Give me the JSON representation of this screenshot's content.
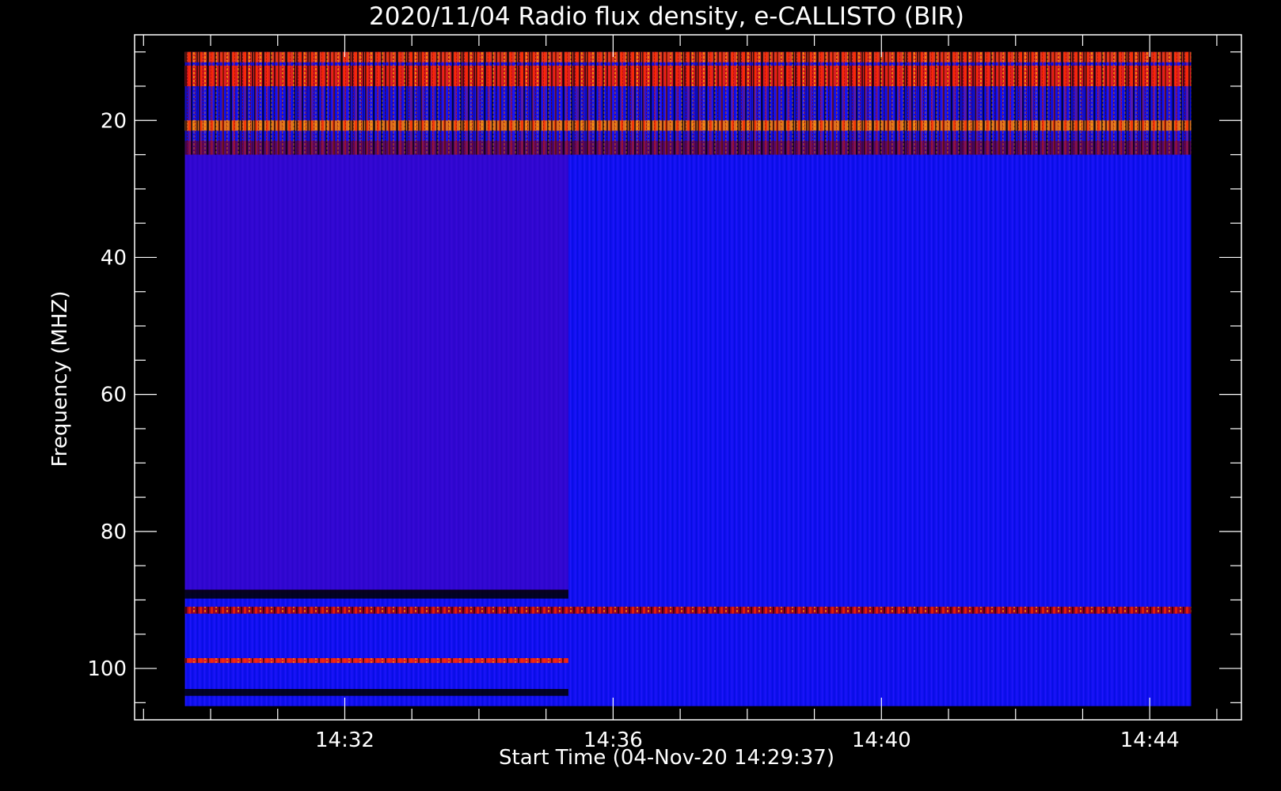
{
  "chart_data": {
    "type": "heatmap",
    "title": "2020/11/04  Radio flux density, e-CALLISTO (BIR)",
    "xlabel": "Start Time (04-Nov-20 14:29:37)",
    "ylabel": "Frequency (MHZ)",
    "x_ticks": [
      "14:32",
      "14:36",
      "14:40",
      "14:44"
    ],
    "y_ticks": [
      "20",
      "40",
      "60",
      "80",
      "100"
    ],
    "x_range": [
      "14:28:52",
      "14:45:22"
    ],
    "y_range": [
      107.5,
      7.5
    ],
    "y_reversed": true,
    "data_time_range": [
      "14:29:37",
      "14:44:37"
    ],
    "data_freq_range_mhz": [
      10,
      105.5
    ],
    "colormap": [
      "#000000",
      "#0000ff",
      "#8b0000",
      "#ff2000",
      "#ffb000",
      "#ffff80"
    ],
    "background": "#000000",
    "foreground": "#ffffff",
    "bands": [
      {
        "freq_mhz": [
          10,
          11.5
        ],
        "time": [
          "14:29:37",
          "14:44:37"
        ],
        "color": "#ff4000",
        "intensity": "high"
      },
      {
        "freq_mhz": [
          12,
          15
        ],
        "time": [
          "14:29:37",
          "14:44:37"
        ],
        "color": "#ff2000",
        "intensity": "high"
      },
      {
        "freq_mhz": [
          20,
          21.5
        ],
        "time": [
          "14:29:37",
          "14:44:37"
        ],
        "color": "#ff8000",
        "intensity": "high"
      },
      {
        "freq_mhz": [
          23,
          25
        ],
        "time": [
          "14:29:37",
          "14:44:37"
        ],
        "color": "#8b0000",
        "intensity": "medium"
      },
      {
        "freq_mhz": [
          25,
          89
        ],
        "time": [
          "14:29:37",
          "14:35:20"
        ],
        "color": "#4a00b8",
        "intensity": "medium"
      },
      {
        "freq_mhz": [
          88.5,
          89.8
        ],
        "time": [
          "14:29:37",
          "14:35:20"
        ],
        "color": "#000000",
        "intensity": "low"
      },
      {
        "freq_mhz": [
          91,
          92
        ],
        "time": [
          "14:29:37",
          "14:44:37"
        ],
        "color": "#b00000",
        "intensity": "high"
      },
      {
        "freq_mhz": [
          98.5,
          99.2
        ],
        "time": [
          "14:29:37",
          "14:35:20"
        ],
        "color": "#ff2000",
        "intensity": "high"
      },
      {
        "freq_mhz": [
          103,
          104
        ],
        "time": [
          "14:29:37",
          "14:35:20"
        ],
        "color": "#000000",
        "intensity": "low"
      }
    ]
  }
}
